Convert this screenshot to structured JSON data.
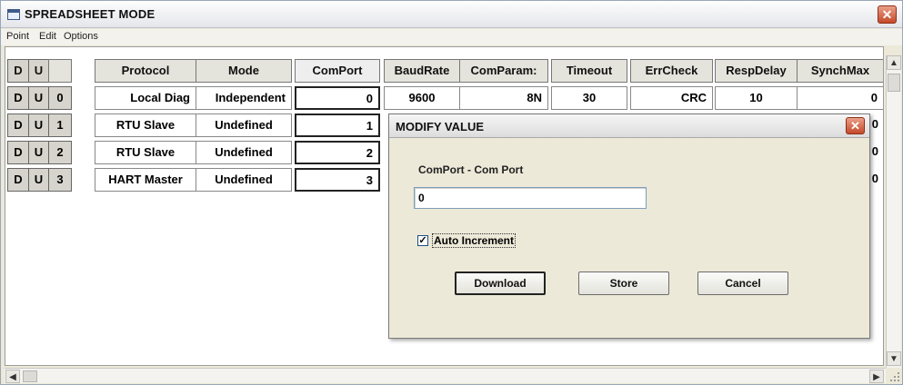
{
  "window": {
    "title": "SPREADSHEET MODE",
    "close_glyph": "✕"
  },
  "menu": [
    "Point",
    "Edit",
    "Options"
  ],
  "table": {
    "du_headers": [
      "D",
      "U"
    ],
    "columns": [
      "Protocol",
      "Mode",
      "ComPort",
      "BaudRate",
      "ComParam:",
      "Timeout",
      "ErrCheck",
      "RespDelay",
      "SynchMax"
    ],
    "rows": [
      {
        "d": "D",
        "u": "U",
        "num": "0",
        "protocol": "Local Diag",
        "mode": "Independent",
        "comport": "0",
        "baudrate": "9600",
        "comparam": "8N",
        "timeout": "30",
        "errcheck": "CRC",
        "respdelay": "10",
        "synchmax": "0"
      },
      {
        "d": "D",
        "u": "U",
        "num": "1",
        "protocol": "RTU Slave",
        "mode": "Undefined",
        "comport": "1",
        "synchmax_partial": "0"
      },
      {
        "d": "D",
        "u": "U",
        "num": "2",
        "protocol": "RTU Slave",
        "mode": "Undefined",
        "comport": "2",
        "synchmax_partial": "0"
      },
      {
        "d": "D",
        "u": "U",
        "num": "3",
        "protocol": "HART Master",
        "mode": "Undefined",
        "comport": "3",
        "synchmax_partial": "0"
      }
    ]
  },
  "dialog": {
    "title": "MODIFY VALUE",
    "close_glyph": "✕",
    "field_label": "ComPort - Com Port",
    "field_value": "0",
    "checkbox_label": "Auto Increment",
    "checkbox_checked": true,
    "checkbox_mark": "✓",
    "buttons": {
      "download": "Download",
      "store": "Store",
      "cancel": "Cancel"
    }
  },
  "scroll": {
    "up": "▲",
    "down": "▼",
    "left": "◀",
    "right": "▶"
  },
  "colors": {
    "close_red": "#c44a2a",
    "header_gray": "#e4e3dc",
    "dialog_bg": "#ece9d8"
  }
}
